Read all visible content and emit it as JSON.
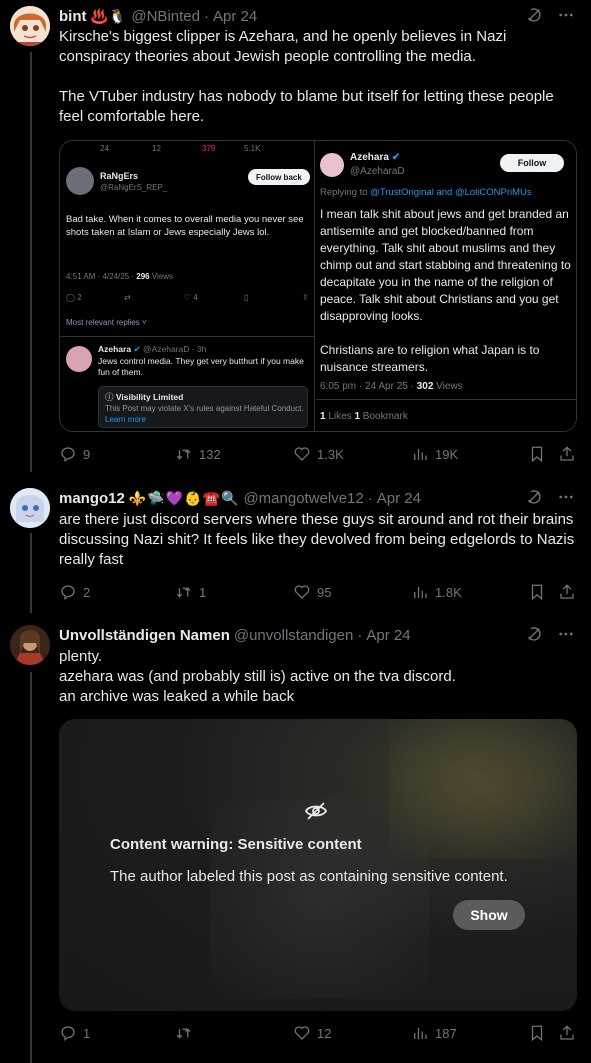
{
  "posts": [
    {
      "name": "bint",
      "emojis": "♨️🐧",
      "handle": "@NBinted",
      "date": "Apr 24",
      "text": "Kirsche's biggest clipper is Azehara, and he openly believes in Nazi conspiracy theories about Jewish people controlling the media.\n\nThe VTuber industry has nobody to blame but itself for letting these people feel comfortable here.",
      "replies": "9",
      "reposts": "132",
      "likes": "1.3K",
      "views": "19K"
    },
    {
      "name": "mango12",
      "emojis": "⚜️🛸💜👶☎️🔍",
      "handle": "@mangotwelve12",
      "date": "Apr 24",
      "text": "are there just discord servers where these guys sit around and rot their brains discussing Nazi shit? It feels like they devolved from being edgelords to Nazis really fast",
      "replies": "2",
      "reposts": "1",
      "likes": "95",
      "views": "1.8K"
    },
    {
      "name": "Unvollständigen Namen",
      "handle": "@unvollstandigen",
      "date": "Apr 24",
      "text": "plenty.\nazehara was (and probably still is) active on the tva discord.\nan archive was leaked a while back",
      "replies": "1",
      "reposts": "",
      "likes": "12",
      "views": "187"
    }
  ],
  "embed": {
    "left": {
      "top_counts": [
        "24",
        "12",
        "379",
        "5.1K"
      ],
      "name": "RaNgErs",
      "handle": "@RaNgErS_REP_",
      "follow_back": "Follow back",
      "text": "Bad take. When it comes to overall media you never see shots taken at Islam or Jews especially Jews lol.",
      "meta_time": "4:51 AM · 4/24/25 · ",
      "meta_views": "296",
      "meta_views_label": " Views",
      "counts": [
        "2",
        "",
        "4"
      ],
      "most_relevant": "Most relevant replies ˅",
      "reply_name": "Azehara",
      "reply_handle": "@AzeharaD · 3h",
      "reply_text": "Jews control media.  They get very butthurt if you make fun of them.",
      "limited_title": "Visibility Limited",
      "limited_text": "This Post may violate X's rules against Hateful Conduct. ",
      "limited_link": "Learn more"
    },
    "right": {
      "name": "Azehara",
      "handle": "@AzeharaD",
      "follow": "Follow",
      "replying_prefix": "Replying to ",
      "replying_users": "@TrustOriginal and @LoliCONPriMUs",
      "text1": "I mean talk shit about jews and get branded an antisemite and get blocked/banned from everything.  Talk shit about muslims and they chimp out and start stabbing and threatening to decapitate you in the name of the religion of peace.  Talk shit about Christians and you get disapproving looks.",
      "text2": "Christians are to religion what Japan is to nuisance streamers.",
      "meta_time": "6:05 pm · 24 Apr 25 · ",
      "meta_views": "302",
      "meta_views_label": " Views",
      "likes": "1",
      "likes_label": " Likes  ",
      "bookmarks": "1",
      "bookmarks_label": " Bookmark"
    }
  },
  "content_warning": {
    "title": "Content warning: Sensitive content",
    "text": "The author labeled this post as containing sensitive content.",
    "button": "Show"
  },
  "colors": {
    "accent": "#1d9bf0",
    "muted": "#71767b",
    "like_pink": "#f91880"
  }
}
